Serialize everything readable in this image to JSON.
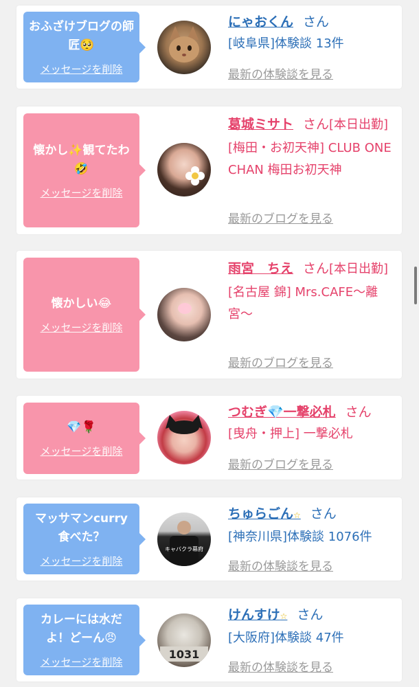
{
  "cards": [
    {
      "bubble": "おふざけブログの師匠🥺",
      "delete_label": "メッセージを削除",
      "name": "にゃおくん",
      "suffix": "さん",
      "line1": "[岐阜県]体験談 13件",
      "line2": "",
      "link": "最新の体験談を見る",
      "color": "blue"
    },
    {
      "bubble": "懐かし✨観てたわ🤣",
      "delete_label": "メッセージを削除",
      "name": "葛城ミサト",
      "suffix": "さん",
      "tag": "[本日出勤]",
      "line1": "[梅田・お初天神] CLUB ONE CHAN 梅田お初天神",
      "link": "最新のブログを見る",
      "color": "pink"
    },
    {
      "bubble": "懐かしい😂",
      "delete_label": "メッセージを削除",
      "name": "雨宮　ちえ",
      "suffix": "さん",
      "tag": "[本日出勤]",
      "line1": "[名古屋 錦] Mrs.CAFE〜離宮〜",
      "link": "最新のブログを見る",
      "color": "pink"
    },
    {
      "bubble": "💎🌹",
      "delete_label": "メッセージを削除",
      "name": "つむぎ💎一撃必札",
      "suffix": "さん",
      "line1": "[曳舟・押上] 一撃必札",
      "link": "最新のブログを見る",
      "color": "pink"
    },
    {
      "bubble": "マッサマンcurry食べた？",
      "delete_label": "メッセージを削除",
      "name": "ちゅらごん",
      "star": "☆",
      "suffix": "さん",
      "line1": "[神奈川県]体験談 1076件",
      "link": "最新の体験談を見る",
      "color": "blue",
      "avatar_text": "キャバクラ幕府"
    },
    {
      "bubble": "カレーには水だよ！どーん😠",
      "delete_label": "メッセージを削除",
      "name": "けんすけ",
      "star": "☆",
      "suffix": "さん",
      "line1": "[大阪府]体験談 47件",
      "link": "最新の体験談を見る",
      "color": "blue",
      "avatar_text": "1031"
    }
  ]
}
